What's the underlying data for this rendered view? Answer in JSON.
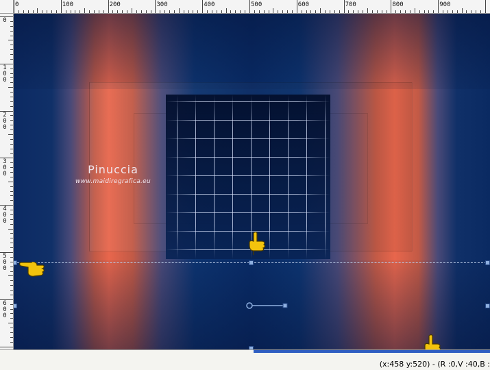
{
  "ruler": {
    "top_labels": [
      "0",
      "100",
      "200",
      "300",
      "400",
      "500",
      "600",
      "700",
      "800",
      "900"
    ],
    "left_labels": [
      "0",
      "1\n0\n0",
      "2\n0\n0",
      "3\n0\n0",
      "4\n0\n0",
      "5\n0\n0",
      "6\n0\n0"
    ]
  },
  "watermark": {
    "name": "Pinuccia",
    "url": "www.maidiregrafica.eu"
  },
  "status": {
    "coordinates": "(x:458 y:520) - (R :0,V :40,B :"
  },
  "icons": {
    "hand_pointer": "pointing-hand-icon",
    "colors": {
      "navy": "#092b66",
      "salmon": "#e8664c",
      "guide": "#b8c8e4"
    }
  }
}
